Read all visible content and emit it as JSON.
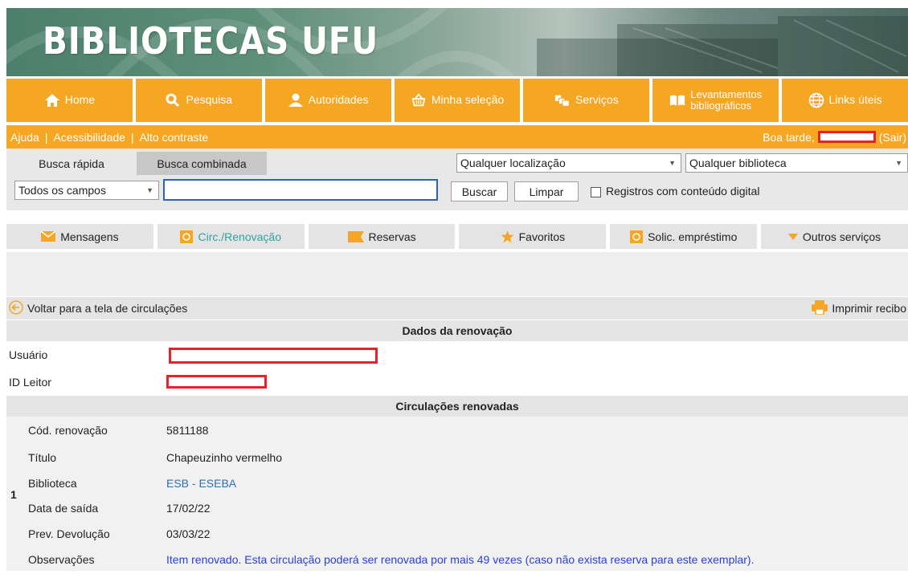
{
  "banner": {
    "title": "BIBLIOTECAS UFU"
  },
  "colors": {
    "accent": "#f5a623",
    "active_tab": "#2ea3a0",
    "link": "#2a6fb8",
    "note": "#2b3fcf",
    "redaction": "#e8202a"
  },
  "main_nav": [
    {
      "label": "Home",
      "icon": "home-icon"
    },
    {
      "label": "Pesquisa",
      "icon": "search-icon"
    },
    {
      "label": "Autoridades",
      "icon": "user-icon"
    },
    {
      "label": "Minha seleção",
      "icon": "basket-icon"
    },
    {
      "label": "Serviços",
      "icon": "services-icon"
    },
    {
      "label_line1": "Levantamentos",
      "label_line2": "bibliográficos",
      "icon": "book-icon"
    },
    {
      "label": "Links úteis",
      "icon": "globe-icon"
    }
  ],
  "top_links": {
    "ajuda": "Ajuda",
    "acessibilidade": "Acessibilidade",
    "alto_contraste": "Alto contraste",
    "separator": "|",
    "greeting": "Boa tarde,",
    "logout": "(Sair)"
  },
  "search": {
    "tabs": [
      "Busca rápida",
      "Busca combinada"
    ],
    "location_select": "Qualquer localização",
    "library_select": "Qualquer biblioteca",
    "field_select": "Todos os campos",
    "query": "",
    "buscar": "Buscar",
    "limpar": "Limpar",
    "digital_only_label": "Registros com conteúdo digital"
  },
  "services": [
    {
      "label": "Mensagens",
      "icon": "mail-icon",
      "active": false
    },
    {
      "label": "Circ./Renovação",
      "icon": "circulation-icon",
      "active": true
    },
    {
      "label": "Reservas",
      "icon": "flag-icon",
      "active": false
    },
    {
      "label": "Favoritos",
      "icon": "star-icon",
      "active": false
    },
    {
      "label": "Solic. empréstimo",
      "icon": "loan-icon",
      "active": false
    },
    {
      "label": "Outros serviços",
      "icon": "caret-down-icon",
      "active": false
    }
  ],
  "actions": {
    "back": "Voltar para a tela de circulações",
    "print": "Imprimir recibo"
  },
  "renewal": {
    "heading": "Dados da renovação",
    "user_label": "Usuário",
    "reader_id_label": "ID Leitor"
  },
  "circulations": {
    "heading": "Circulações renovadas",
    "index": "1",
    "rows": [
      {
        "label": "Cód. renovação",
        "value": "5811188"
      },
      {
        "label": "Título",
        "value": "Chapeuzinho vermelho"
      },
      {
        "label": "Biblioteca",
        "value": "ESB - ESEBA"
      },
      {
        "label": "Data de saída",
        "value": "17/02/22"
      },
      {
        "label": "Prev. Devolução",
        "value": "03/03/22"
      },
      {
        "label": "Observações",
        "value": "Item renovado. Esta circulação poderá ser renovada por mais 49 vezes (caso não exista reserva para este exemplar)."
      }
    ]
  }
}
